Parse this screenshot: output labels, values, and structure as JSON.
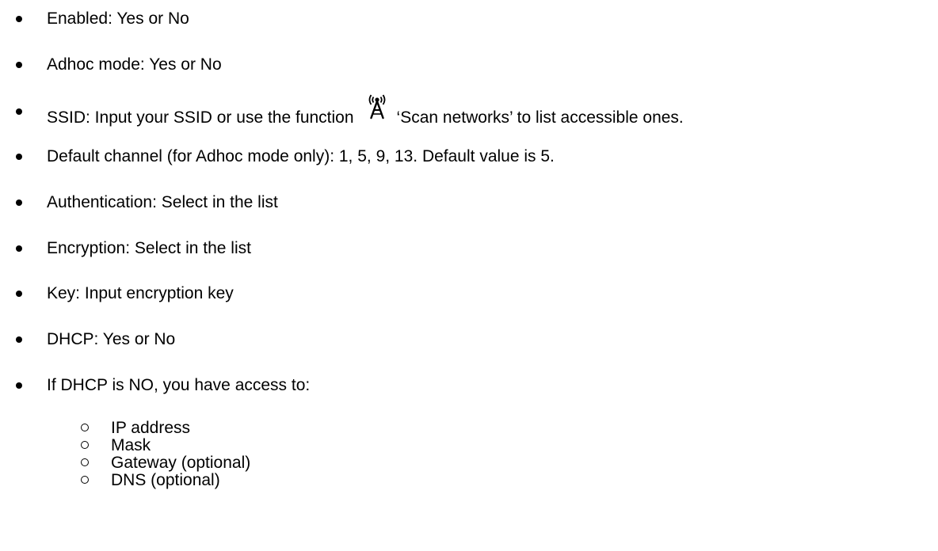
{
  "bullets": [
    {
      "text": "Enabled: Yes or No"
    },
    {
      "text": "Adhoc mode: Yes or No"
    },
    {
      "text_before": "SSID: Input your SSID or use the function",
      "icon": "antenna-icon",
      "text_after": "‘Scan networks’ to list accessible ones."
    },
    {
      "text": "Default channel (for Adhoc mode only): 1, 5, 9, 13. Default value is 5."
    },
    {
      "text": "Authentication: Select in the list"
    },
    {
      "text": "Encryption: Select in the list"
    },
    {
      "text": "Key: Input encryption key"
    },
    {
      "text": "DHCP: Yes or No"
    },
    {
      "text": "If DHCP is NO, you have access to:"
    }
  ],
  "sub_items": [
    {
      "text": "IP address"
    },
    {
      "text": "Mask"
    },
    {
      "text": "Gateway (optional)"
    },
    {
      "text": "DNS (optional)"
    }
  ]
}
